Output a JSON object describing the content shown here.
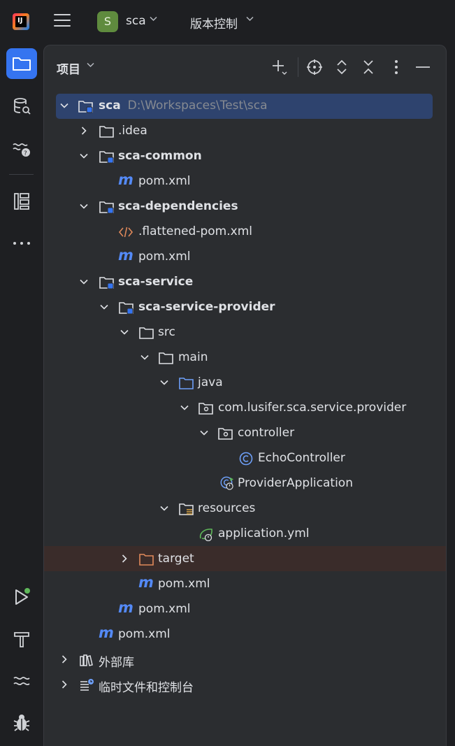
{
  "topbar": {
    "logo_text": "IJ",
    "project_badge": "S",
    "project_name": "sca",
    "vcs_label": "版本控制"
  },
  "panel": {
    "title": "项目"
  },
  "tree": {
    "root": {
      "name": "sca",
      "path": "D:\\Workspaces\\Test\\sca"
    },
    "idea": ".idea",
    "sca_common": "sca-common",
    "common_pom": "pom.xml",
    "sca_dependencies": "sca-dependencies",
    "flattened_pom": ".flattened-pom.xml",
    "dependencies_pom": "pom.xml",
    "sca_service": "sca-service",
    "sca_service_provider": "sca-service-provider",
    "src": "src",
    "main": "main",
    "java": "java",
    "package": "com.lusifer.sca.service.provider",
    "controller": "controller",
    "echo_controller": "EchoController",
    "provider_application": "ProviderApplication",
    "resources": "resources",
    "application_yml": "application.yml",
    "target": "target",
    "provider_pom": "pom.xml",
    "service_pom": "pom.xml",
    "root_pom": "pom.xml",
    "external_libs": "外部库",
    "scratches": "临时文件和控制台"
  },
  "colors": {
    "accent": "#3574f0",
    "selection": "#2e436e",
    "maven_m": "#548af7",
    "target_folder": "#e0895b"
  }
}
